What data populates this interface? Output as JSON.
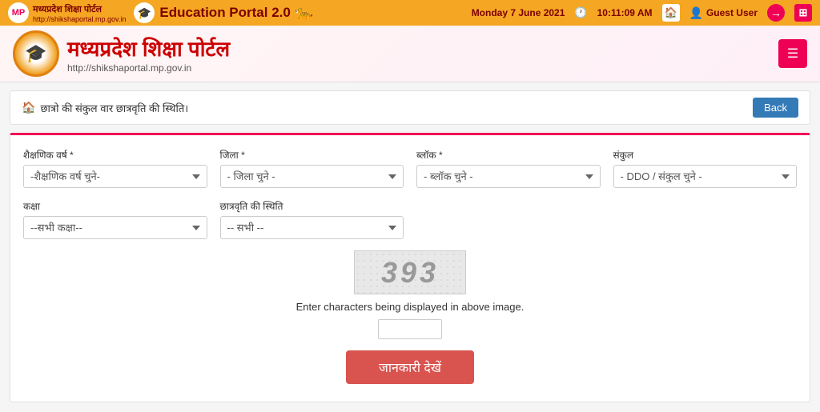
{
  "topBar": {
    "leftLogoText": "मध्यप्रदेश शिक्षा पोर्टल",
    "leftSiteUrl": "http://shikshaportal.mp.gov.in",
    "portalTitle": "Education Portal 2.0",
    "dateTime": "Monday 7 June 2021",
    "time": "10:11:09 AM",
    "guestUser": "Guest User",
    "homeIconLabel": "🏠",
    "userIconLabel": "👤",
    "loginIconLabel": "→",
    "menuIconLabel": "⊞"
  },
  "secondaryHeader": {
    "portalName": "मध्यप्रदेश शिक्षा पोर्टल",
    "portalUrl": "http://shikshaportal.mp.gov.in",
    "emblemIcon": "🎓"
  },
  "breadcrumb": {
    "homeIcon": "🏠",
    "text": "छात्रो की संकुल वार छात्रवृति की स्थिति।",
    "backButton": "Back"
  },
  "form": {
    "academicYearLabel": "शैक्षणिक वर्ष *",
    "academicYearPlaceholder": "-शैक्षणिक वर्ष चुने-",
    "districtLabel": "जिला *",
    "districtPlaceholder": "- जिला चुने -",
    "blockLabel": "ब्लॉक *",
    "blockPlaceholder": "- ब्लॉक चुने -",
    "sankulLabel": "संकुल",
    "sankulPlaceholder": "- DDO / संकुल चुने -",
    "classLabel": "कक्षा",
    "classPlaceholder": "--सभी कक्षा--",
    "scholarshipStatusLabel": "छात्रवृति की स्थिति",
    "scholarshipStatusPlaceholder": "-- सभी --"
  },
  "captcha": {
    "value": "393",
    "instructionText": "Enter characters being displayed in above image.",
    "inputPlaceholder": ""
  },
  "submitButton": {
    "label": "जानकारी देखें"
  }
}
